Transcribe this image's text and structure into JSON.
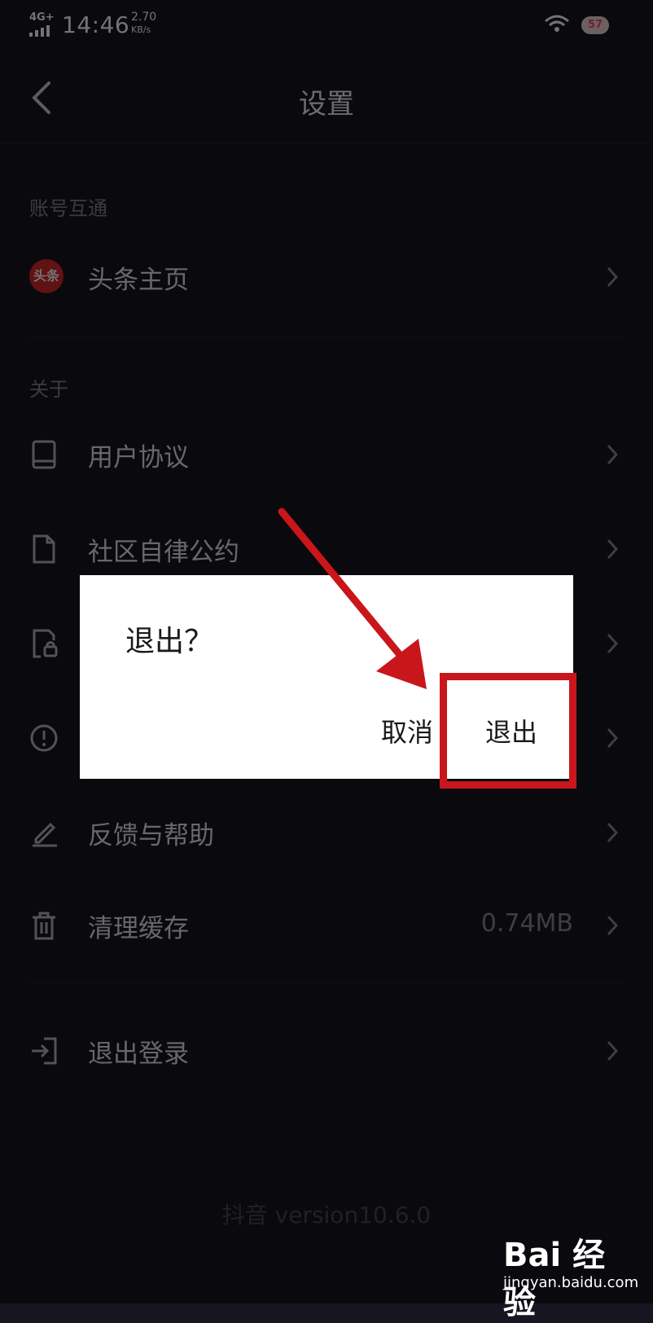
{
  "status_bar": {
    "network": "4G+",
    "time": "14:46",
    "speed_value": "2.70",
    "speed_unit": "KB/s",
    "battery": "57"
  },
  "header": {
    "title": "设置",
    "back_icon": "chevron-left-icon"
  },
  "sections": [
    {
      "label": "账号互通",
      "items": [
        {
          "label": "头条主页",
          "icon": "toutiao-logo",
          "icon_text": "头条"
        }
      ]
    },
    {
      "label": "关于",
      "items": [
        {
          "label": "用户协议",
          "icon": "book-icon"
        },
        {
          "label": "社区自律公约",
          "icon": "document-icon"
        },
        {
          "label": "",
          "icon": "lock-document-icon"
        },
        {
          "label": "",
          "icon": "exclamation-icon"
        },
        {
          "label": "反馈与帮助",
          "icon": "pencil-icon"
        },
        {
          "label": "清理缓存",
          "icon": "trash-icon",
          "value": "0.74MB"
        }
      ]
    },
    {
      "label": "",
      "items": [
        {
          "label": "退出登录",
          "icon": "logout-icon"
        }
      ]
    }
  ],
  "footer": {
    "version": "抖音 version10.6.0"
  },
  "dialog": {
    "title": "退出？",
    "cancel_label": "取消",
    "confirm_label": "退出"
  },
  "watermark": {
    "logo": "Bai 经验",
    "sub": "jingyan.baidu.com"
  },
  "colors": {
    "background": "#161620",
    "dialog_bg": "#ffffff",
    "annotation_red": "#c8161b",
    "toutiao_red": "#d8282a"
  }
}
